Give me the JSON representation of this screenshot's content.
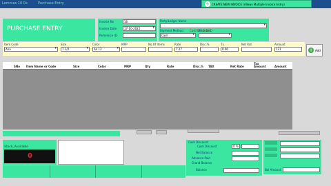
{
  "titlebar": {
    "left_text": "Lemmas 10 Rs",
    "right_text": "Purchase Entry",
    "create_button": "CREATE NEW INVOICE (Allows Multiple Invoice Entry)"
  },
  "header": {
    "title": "PURCHASE ENTRY",
    "invoice_no_label": "Invoice No",
    "invoice_no_value": "16",
    "invoice_date_label": "Invoice Date",
    "invoice_date_value": "17-10-2022",
    "reference_label": "Reference ID",
    "reference_value": "",
    "party_label": "Party/Ledger Name",
    "party_value": "",
    "cust_bal_label": "Cust Bal: 0.00 Cr",
    "payment_label": "Payment Method",
    "payment_value": "Cash",
    "price_list_label": "Price List",
    "price_list_value": ""
  },
  "entry_row": {
    "labels": [
      "Item Code",
      "Size",
      "Color",
      "MRP",
      "No Of Items",
      "Rate",
      "Disc.%",
      "Tx",
      "Net Rat",
      "Amount"
    ],
    "values": [
      "Ana",
      "7.1/2",
      "An 12",
      "",
      "",
      "",
      "7.27",
      "0.00",
      "",
      "",
      "131.11",
      "131"
    ],
    "add_button": "Add"
  },
  "table": {
    "columns": [
      "SNo",
      "Item Name or Code",
      "Size",
      "Color",
      "MRP",
      "Qty",
      "Rate",
      "Disc.%",
      "TAX",
      "Net Rate",
      "Tax Amount",
      "Amount"
    ]
  },
  "stock": {
    "label": "Stock_Available",
    "value": "0"
  },
  "summary": {
    "cash_discount": "Cash Discount",
    "cash_discount_value": "0 %",
    "net_balance": "Net Balance",
    "advance_paid": "Advance Paid",
    "grand_balance": "Grand Balance",
    "balance": "Balance",
    "bal_amount": "Bal Amount"
  },
  "colors": {
    "green": "#3be6a0",
    "blue_header": "#1c4d8c",
    "stock_red": "#e3212f"
  }
}
